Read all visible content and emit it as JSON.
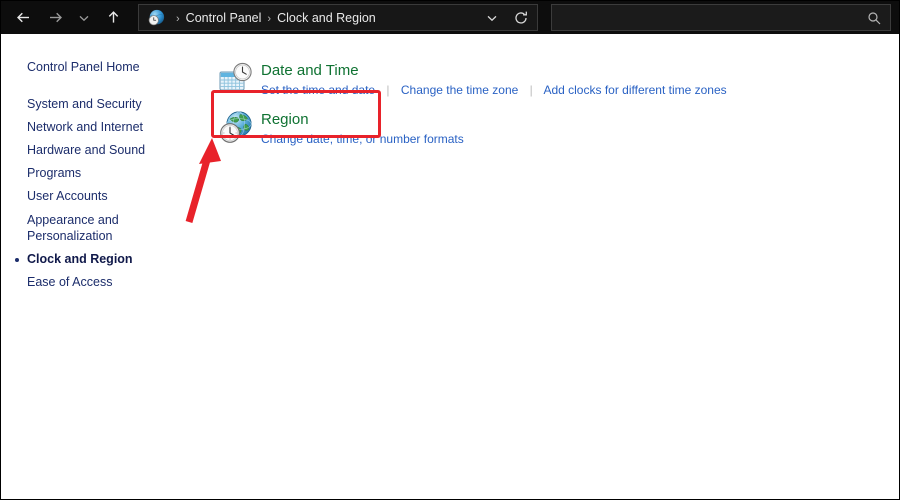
{
  "window": {
    "title": "Control Panel - Clock and Region"
  },
  "nav": {
    "back_icon": "back-arrow-icon",
    "forward_icon": "forward-arrow-icon",
    "recent_icon": "chevron-down-icon",
    "up_icon": "up-arrow-icon",
    "refresh_icon": "refresh-icon",
    "address_dropdown_icon": "chevron-down-icon"
  },
  "breadcrumb": {
    "icon": "clock-region-icon",
    "separator": "›",
    "items": [
      {
        "label": "Control Panel"
      },
      {
        "label": "Clock and Region"
      }
    ]
  },
  "search": {
    "icon": "search-icon",
    "value": "",
    "placeholder": ""
  },
  "sidebar": {
    "items": [
      {
        "label": "Control Panel Home",
        "active": false
      },
      {
        "label": "System and Security",
        "active": false
      },
      {
        "label": "Network and Internet",
        "active": false
      },
      {
        "label": "Hardware and Sound",
        "active": false
      },
      {
        "label": "Programs",
        "active": false
      },
      {
        "label": "User Accounts",
        "active": false
      },
      {
        "label": "Appearance and Personalization",
        "active": false
      },
      {
        "label": "Clock and Region",
        "active": true
      },
      {
        "label": "Ease of Access",
        "active": false
      }
    ]
  },
  "main": {
    "categories": [
      {
        "icon": "date-and-time-icon",
        "title": "Date and Time",
        "links": [
          "Set the time and date",
          "Change the time zone",
          "Add clocks for different time zones"
        ]
      },
      {
        "icon": "region-globe-clock-icon",
        "title": "Region",
        "links": [
          "Change date, time, or number formats"
        ]
      }
    ]
  },
  "annotations": {
    "highlight_color": "#e8222a",
    "arrow_color": "#e8222a",
    "highlight_target": "Date and Time",
    "arrow_target": "Date and Time"
  },
  "colors": {
    "titlebar_bg": "#0d0d0d",
    "page_bg": "#ffffff",
    "sidebar_link": "#1c2d6b",
    "category_title": "#0f7232",
    "category_link": "#2a62c4",
    "annotation_red": "#e8222a"
  }
}
